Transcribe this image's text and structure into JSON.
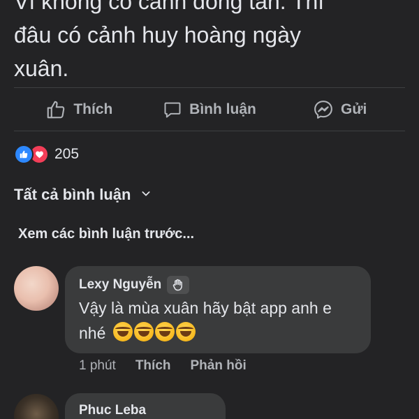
{
  "post": {
    "text_lines": [
      "Vì không có cảnh đông tàn. Thì",
      "đâu có cảnh huy hoàng ngày",
      "xuân."
    ]
  },
  "actions": {
    "like_label": "Thích",
    "comment_label": "Bình luận",
    "send_label": "Gửi"
  },
  "reactions": {
    "icons": [
      "like-icon",
      "love-icon"
    ],
    "count": "205"
  },
  "comments_header": {
    "sort_label": "Tất cả bình luận",
    "view_previous": "Xem các bình luận trước..."
  },
  "comments": [
    {
      "author": "Lexy Nguyễn",
      "badge_icon": "fan-badge-icon",
      "text_line_1": "Vậy là mùa xuân hãy bật app anh e",
      "text_line_2": "nhé",
      "emoji_count": 4,
      "emoji_icon": "rofl-emoji",
      "time": "1 phút",
      "like_label": "Thích",
      "reply_label": "Phản hồi"
    },
    {
      "author": "Phuc Leba"
    }
  ],
  "colors": {
    "background": "#232325",
    "bubble": "#3a3b3c",
    "text": "#e4e6eb",
    "muted": "#b0b3b8",
    "like_blue": "#2d88ff",
    "love_red": "#f33e58"
  }
}
